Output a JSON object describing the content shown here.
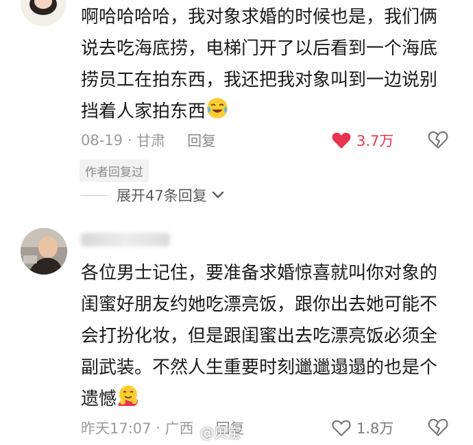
{
  "comments": [
    {
      "text": "啊哈哈哈哈，我对象求婚的时候也是，我们俩说去吃海底捞，电梯门开了以后看到一个海底捞员工在拍东西，我还把我对象叫到一边说别挡着人家拍东西",
      "emoji": "crying-laughing-emoji",
      "date": "08-19",
      "location": "甘肃",
      "reply_label": "回复",
      "likes": "3.7万",
      "liked": true,
      "author_badge": "作者回复过",
      "expand_label": "展开47条回复"
    },
    {
      "text": "各位男士记住，要准备求婚惊喜就叫你对象的闺蜜好朋友约她吃漂亮饭，跟你出去她可能不会打扮化妆，但是跟闺蜜出去吃漂亮饭必须全副武装。不然人生重要时刻邋邋遢遢的也是个遗憾",
      "emoji": "hugging-emoji",
      "date": "昨天17:07",
      "location": "广西",
      "reply_label": "回复",
      "likes": "1.8万",
      "liked": false
    }
  ],
  "watermark": "@贝宝",
  "colors": {
    "like_active": "#e8344e",
    "meta_gray": "#9b9b9b"
  }
}
